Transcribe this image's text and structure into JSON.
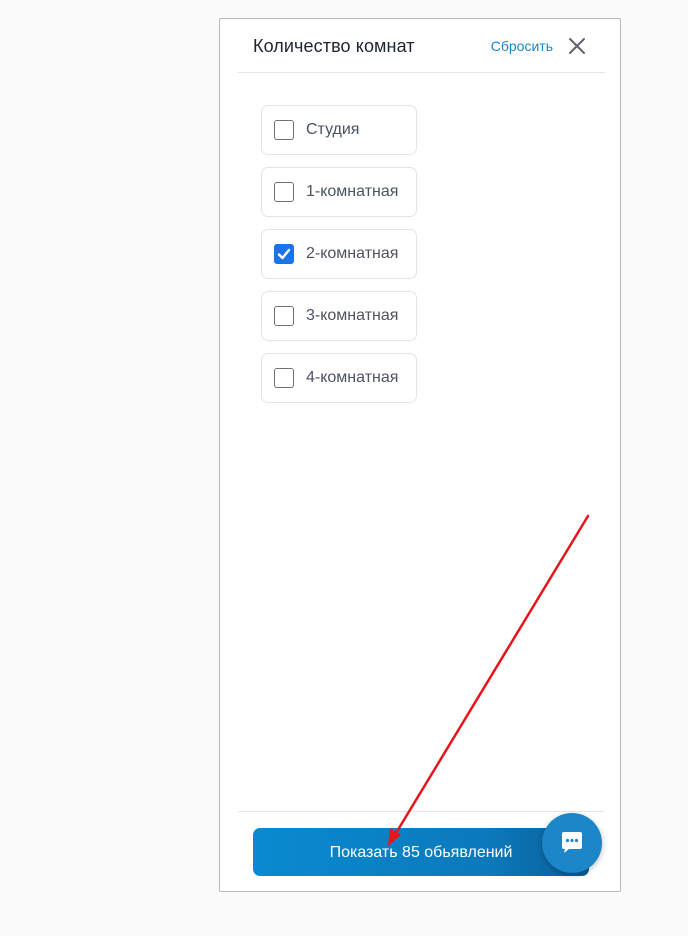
{
  "filter_panel": {
    "title": "Количество комнат",
    "reset_label": "Сбросить",
    "close_icon": "close-icon"
  },
  "options": [
    {
      "label": "Студия",
      "checked": false
    },
    {
      "label": "1-комнатная",
      "checked": false
    },
    {
      "label": "2-комнатная",
      "checked": true
    },
    {
      "label": "3-комнатная",
      "checked": false
    },
    {
      "label": "4-комнатная",
      "checked": false
    }
  ],
  "footer": {
    "show_button_label": "Показать 85 обьявлений"
  },
  "chat_widget": {
    "icon": "chat-icon"
  },
  "colors": {
    "accent": "#1a86c6",
    "checkbox_checked": "#1a73e8",
    "annotation_arrow": "#e8141c"
  }
}
